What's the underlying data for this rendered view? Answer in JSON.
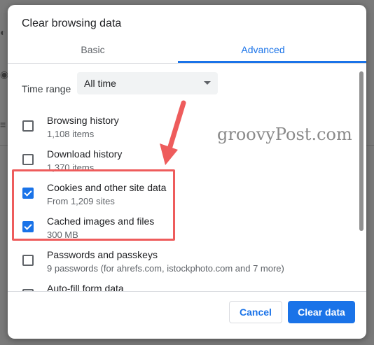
{
  "dialog": {
    "title": "Clear browsing data",
    "tabs": [
      {
        "label": "Basic",
        "active": false
      },
      {
        "label": "Advanced",
        "active": true
      }
    ],
    "time_range": {
      "label": "Time range",
      "value": "All time"
    },
    "items": [
      {
        "title": "Browsing history",
        "subtitle": "1,108 items",
        "checked": false
      },
      {
        "title": "Download history",
        "subtitle": "1,370 items",
        "checked": false
      },
      {
        "title": "Cookies and other site data",
        "subtitle": "From 1,209 sites",
        "checked": true
      },
      {
        "title": "Cached images and files",
        "subtitle": "300 MB",
        "checked": true
      },
      {
        "title": "Passwords and passkeys",
        "subtitle": "9 passwords (for ahrefs.com, istockphoto.com and 7 more)",
        "checked": false
      },
      {
        "title": "Auto-fill form data",
        "subtitle": "",
        "checked": false
      }
    ],
    "buttons": {
      "cancel": "Cancel",
      "clear": "Clear data"
    }
  },
  "watermark": "groovyPost.com",
  "colors": {
    "accent": "#1a73e8",
    "highlight": "#ee5c5c"
  }
}
